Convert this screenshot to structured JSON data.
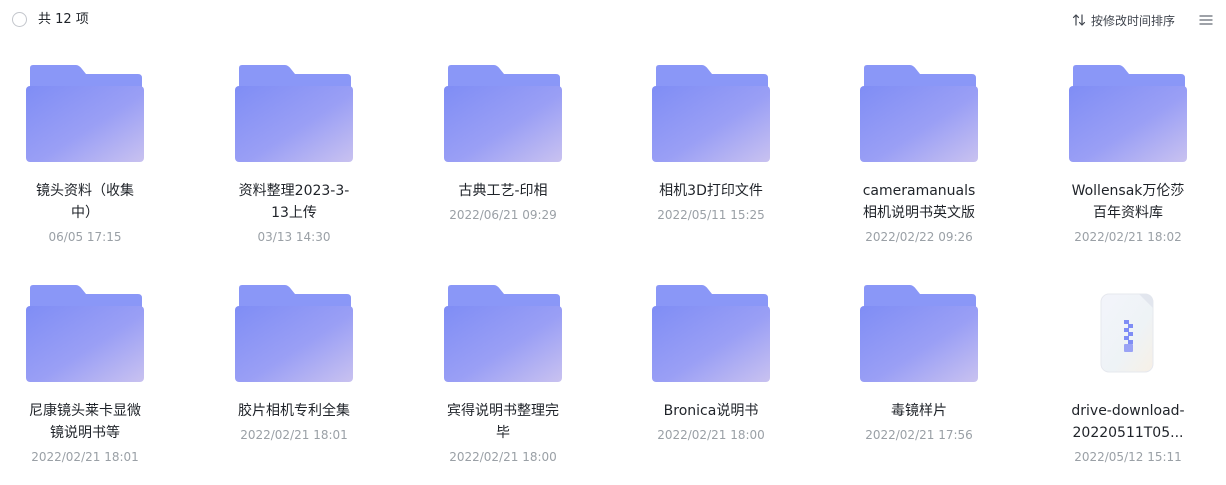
{
  "toolbar": {
    "count_label": "共 12 项",
    "sort_label": "按修改时间排序"
  },
  "colors": {
    "folder_back": "#8a97f7",
    "folder_front_top": "#7f8df5",
    "folder_front_bottom": "#c9c2f0",
    "muted_text": "#9aa0a6"
  },
  "items": [
    {
      "type": "folder",
      "name_lines": [
        "镜头资料（收集",
        "中）"
      ],
      "time": "06/05 17:15"
    },
    {
      "type": "folder",
      "name_lines": [
        "资料整理2023-3-",
        "13上传"
      ],
      "time": "03/13 14:30"
    },
    {
      "type": "folder",
      "name_lines": [
        "古典工艺-印相"
      ],
      "time": "2022/06/21 09:29"
    },
    {
      "type": "folder",
      "name_lines": [
        "相机3D打印文件"
      ],
      "time": "2022/05/11 15:25"
    },
    {
      "type": "folder",
      "name_lines": [
        "cameramanuals",
        "相机说明书英文版"
      ],
      "time": "2022/02/22 09:26"
    },
    {
      "type": "folder",
      "name_lines": [
        "Wollensak万伦莎",
        "百年资料库"
      ],
      "time": "2022/02/21 18:02"
    },
    {
      "type": "folder",
      "name_lines": [
        "尼康镜头莱卡显微",
        "镜说明书等"
      ],
      "time": "2022/02/21 18:01"
    },
    {
      "type": "folder",
      "name_lines": [
        "胶片相机专利全集"
      ],
      "time": "2022/02/21 18:01"
    },
    {
      "type": "folder",
      "name_lines": [
        "宾得说明书整理完",
        "毕"
      ],
      "time": "2022/02/21 18:00"
    },
    {
      "type": "folder",
      "name_lines": [
        "Bronica说明书"
      ],
      "time": "2022/02/21 18:00"
    },
    {
      "type": "folder",
      "name_lines": [
        "毒镜样片"
      ],
      "time": "2022/02/21 17:56"
    },
    {
      "type": "zip",
      "name_lines": [
        "drive-download-",
        "20220511T05..."
      ],
      "time": "2022/05/12 15:11"
    }
  ]
}
